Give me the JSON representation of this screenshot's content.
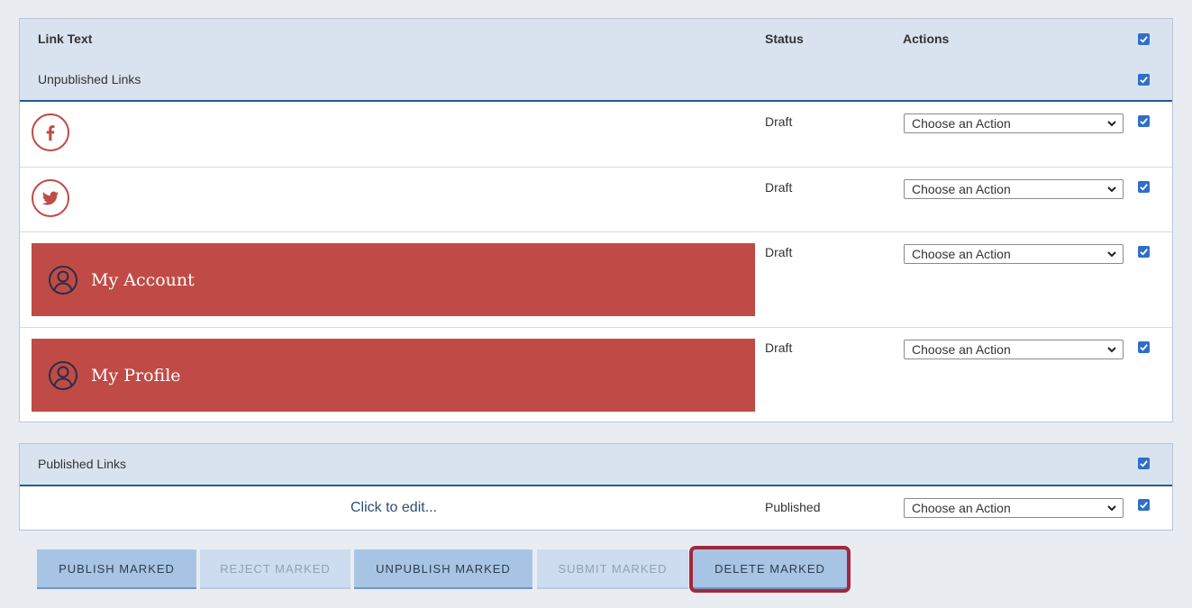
{
  "table": {
    "col_link_text": "Link Text",
    "col_status": "Status",
    "col_actions": "Actions"
  },
  "unpublished": {
    "label": "Unpublished Links",
    "rows": [
      {
        "type": "facebook-icon",
        "status": "Draft",
        "action": "Choose an Action"
      },
      {
        "type": "twitter-icon",
        "status": "Draft",
        "action": "Choose an Action"
      },
      {
        "type": "banner",
        "label": "My Account",
        "status": "Draft",
        "action": "Choose an Action"
      },
      {
        "type": "banner",
        "label": "My Profile",
        "status": "Draft",
        "action": "Choose an Action"
      }
    ]
  },
  "published": {
    "label": "Published Links",
    "rows": [
      {
        "link_text": "Click to edit...",
        "status": "Published",
        "action": "Choose an Action"
      }
    ]
  },
  "buttons": {
    "publish": "PUBLISH MARKED",
    "reject": "REJECT MARKED",
    "unpublish": "UNPUBLISH MARKED",
    "submit": "SUBMIT MARKED",
    "delete": "DELETE MARKED"
  },
  "colors": {
    "brand_red": "#c04b46",
    "header_bg": "#d9e3ef",
    "checkbox_blue": "#2f6fc7",
    "focus_outline": "#a3283b"
  }
}
